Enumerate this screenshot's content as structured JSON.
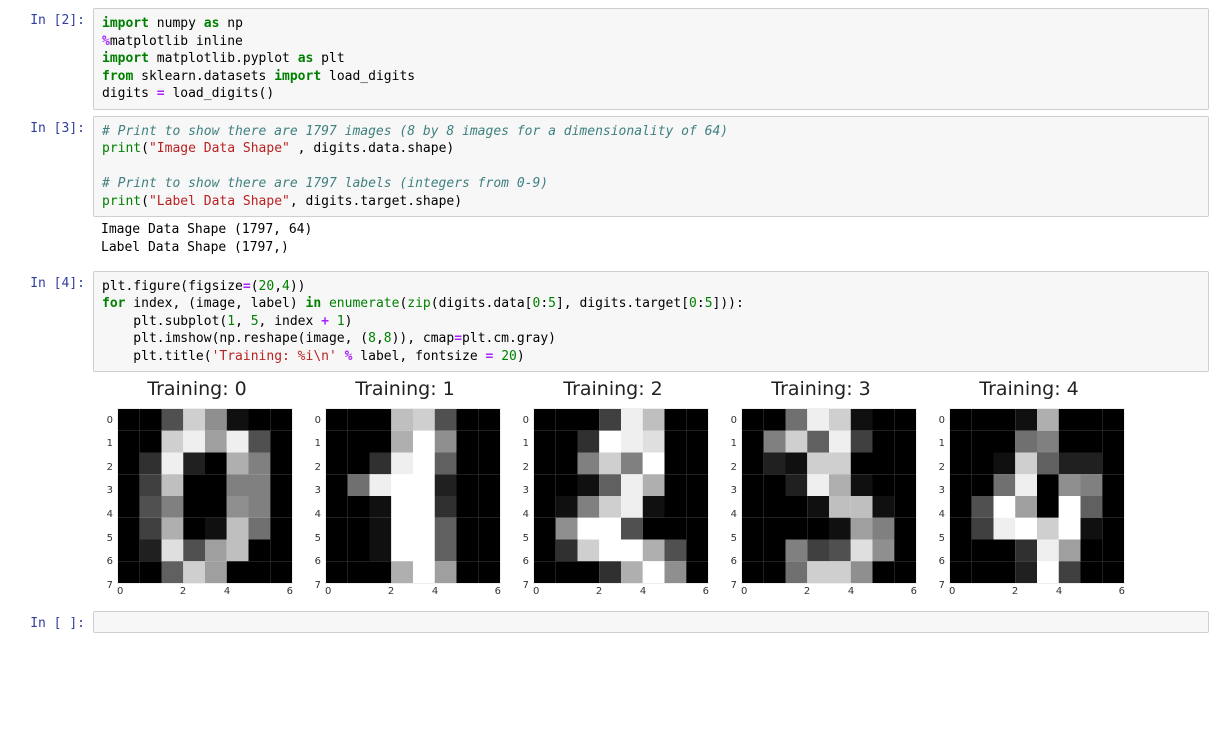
{
  "cells": {
    "c1": {
      "prompt": "In [2]:",
      "code_html": "<span class='tok-kw'>import</span> <span class='tok-name'>numpy</span> <span class='tok-kw'>as</span> <span class='tok-name'>np</span>\n<span class='tok-op'>%</span><span class='tok-name'>matplotlib inline</span>\n<span class='tok-kw'>import</span> <span class='tok-name'>matplotlib.pyplot</span> <span class='tok-kw'>as</span> <span class='tok-name'>plt</span>\n<span class='tok-kw'>from</span> <span class='tok-name'>sklearn.datasets</span> <span class='tok-kw'>import</span> <span class='tok-name'>load_digits</span>\n<span class='tok-name'>digits</span> <span class='tok-op'>=</span> <span class='tok-name'>load_digits()</span>"
    },
    "c2": {
      "prompt": "In [3]:",
      "code_html": "<span class='tok-cmt'># Print to show there are 1797 images (8 by 8 images for a dimensionality of 64)</span>\n<span class='tok-bi'>print</span>(<span class='tok-str'>\"Image Data Shape\"</span> , digits.data.shape)\n\n<span class='tok-cmt'># Print to show there are 1797 labels (integers from 0-9)</span>\n<span class='tok-bi'>print</span>(<span class='tok-str'>\"Label Data Shape\"</span>, digits.target.shape)",
      "stdout": "Image Data Shape (1797, 64)\nLabel Data Shape (1797,)"
    },
    "c3": {
      "prompt": "In [4]:",
      "code_html": "plt.figure(figsize<span class='tok-op'>=</span>(<span class='tok-num'>20</span>,<span class='tok-num'>4</span>))\n<span class='tok-kw'>for</span> index, (image, label) <span class='tok-kw'>in</span> <span class='tok-bi'>enumerate</span>(<span class='tok-bi'>zip</span>(digits.data[<span class='tok-num'>0</span>:<span class='tok-num'>5</span>], digits.target[<span class='tok-num'>0</span>:<span class='tok-num'>5</span>])):\n    plt.subplot(<span class='tok-num'>1</span>, <span class='tok-num'>5</span>, index <span class='tok-op'>+</span> <span class='tok-num'>1</span>)\n    plt.imshow(np.reshape(image, (<span class='tok-num'>8</span>,<span class='tok-num'>8</span>)), cmap<span class='tok-op'>=</span>plt.cm.gray)\n    plt.title(<span class='tok-str'>'Training: %i\\n'</span> <span class='tok-op'>%</span> label, fontsize <span class='tok-op'>=</span> <span class='tok-num'>20</span>)"
    },
    "c4": {
      "prompt": "In [ ]:"
    }
  },
  "figure": {
    "y_ticks": [
      "0",
      "1",
      "2",
      "3",
      "4",
      "5",
      "6",
      "7"
    ],
    "x_ticks": [
      "0",
      "2",
      "4",
      "6"
    ],
    "pixel_size": 22
  },
  "chart_data": [
    {
      "type": "heatmap",
      "title": "Training: 0",
      "xlabel": "",
      "ylabel": "",
      "x_ticks": [
        0,
        2,
        4,
        6
      ],
      "y_ticks": [
        0,
        1,
        2,
        3,
        4,
        5,
        6,
        7
      ],
      "cmap": "gray",
      "vmin": 0,
      "vmax": 16,
      "values": [
        [
          0,
          0,
          5,
          13,
          9,
          1,
          0,
          0
        ],
        [
          0,
          0,
          13,
          15,
          10,
          15,
          5,
          0
        ],
        [
          0,
          3,
          15,
          2,
          0,
          11,
          8,
          0
        ],
        [
          0,
          4,
          12,
          0,
          0,
          8,
          8,
          0
        ],
        [
          0,
          5,
          8,
          0,
          0,
          9,
          8,
          0
        ],
        [
          0,
          4,
          11,
          0,
          1,
          12,
          7,
          0
        ],
        [
          0,
          2,
          14,
          5,
          10,
          12,
          0,
          0
        ],
        [
          0,
          0,
          6,
          13,
          10,
          0,
          0,
          0
        ]
      ]
    },
    {
      "type": "heatmap",
      "title": "Training: 1",
      "xlabel": "",
      "ylabel": "",
      "x_ticks": [
        0,
        2,
        4,
        6
      ],
      "y_ticks": [
        0,
        1,
        2,
        3,
        4,
        5,
        6,
        7
      ],
      "cmap": "gray",
      "vmin": 0,
      "vmax": 16,
      "values": [
        [
          0,
          0,
          0,
          12,
          13,
          5,
          0,
          0
        ],
        [
          0,
          0,
          0,
          11,
          16,
          9,
          0,
          0
        ],
        [
          0,
          0,
          3,
          15,
          16,
          6,
          0,
          0
        ],
        [
          0,
          7,
          15,
          16,
          16,
          2,
          0,
          0
        ],
        [
          0,
          0,
          1,
          16,
          16,
          3,
          0,
          0
        ],
        [
          0,
          0,
          1,
          16,
          16,
          6,
          0,
          0
        ],
        [
          0,
          0,
          1,
          16,
          16,
          6,
          0,
          0
        ],
        [
          0,
          0,
          0,
          11,
          16,
          10,
          0,
          0
        ]
      ]
    },
    {
      "type": "heatmap",
      "title": "Training: 2",
      "xlabel": "",
      "ylabel": "",
      "x_ticks": [
        0,
        2,
        4,
        6
      ],
      "y_ticks": [
        0,
        1,
        2,
        3,
        4,
        5,
        6,
        7
      ],
      "cmap": "gray",
      "vmin": 0,
      "vmax": 16,
      "values": [
        [
          0,
          0,
          0,
          4,
          15,
          12,
          0,
          0
        ],
        [
          0,
          0,
          3,
          16,
          15,
          14,
          0,
          0
        ],
        [
          0,
          0,
          8,
          13,
          8,
          16,
          0,
          0
        ],
        [
          0,
          0,
          1,
          6,
          15,
          11,
          0,
          0
        ],
        [
          0,
          1,
          8,
          13,
          15,
          1,
          0,
          0
        ],
        [
          0,
          9,
          16,
          16,
          5,
          0,
          0,
          0
        ],
        [
          0,
          3,
          13,
          16,
          16,
          11,
          5,
          0
        ],
        [
          0,
          0,
          0,
          3,
          11,
          16,
          9,
          0
        ]
      ]
    },
    {
      "type": "heatmap",
      "title": "Training: 3",
      "xlabel": "",
      "ylabel": "",
      "x_ticks": [
        0,
        2,
        4,
        6
      ],
      "y_ticks": [
        0,
        1,
        2,
        3,
        4,
        5,
        6,
        7
      ],
      "cmap": "gray",
      "vmin": 0,
      "vmax": 16,
      "values": [
        [
          0,
          0,
          7,
          15,
          13,
          1,
          0,
          0
        ],
        [
          0,
          8,
          13,
          6,
          15,
          4,
          0,
          0
        ],
        [
          0,
          2,
          1,
          13,
          13,
          0,
          0,
          0
        ],
        [
          0,
          0,
          2,
          15,
          11,
          1,
          0,
          0
        ],
        [
          0,
          0,
          0,
          1,
          12,
          12,
          1,
          0
        ],
        [
          0,
          0,
          0,
          0,
          1,
          10,
          8,
          0
        ],
        [
          0,
          0,
          8,
          4,
          5,
          14,
          9,
          0
        ],
        [
          0,
          0,
          7,
          13,
          13,
          9,
          0,
          0
        ]
      ]
    },
    {
      "type": "heatmap",
      "title": "Training: 4",
      "xlabel": "",
      "ylabel": "",
      "x_ticks": [
        0,
        2,
        4,
        6
      ],
      "y_ticks": [
        0,
        1,
        2,
        3,
        4,
        5,
        6,
        7
      ],
      "cmap": "gray",
      "vmin": 0,
      "vmax": 16,
      "values": [
        [
          0,
          0,
          0,
          1,
          11,
          0,
          0,
          0
        ],
        [
          0,
          0,
          0,
          7,
          8,
          0,
          0,
          0
        ],
        [
          0,
          0,
          1,
          13,
          6,
          2,
          2,
          0
        ],
        [
          0,
          0,
          7,
          15,
          0,
          9,
          8,
          0
        ],
        [
          0,
          5,
          16,
          10,
          0,
          16,
          6,
          0
        ],
        [
          0,
          4,
          15,
          16,
          13,
          16,
          1,
          0
        ],
        [
          0,
          0,
          0,
          3,
          15,
          10,
          0,
          0
        ],
        [
          0,
          0,
          0,
          2,
          16,
          4,
          0,
          0
        ]
      ]
    }
  ]
}
